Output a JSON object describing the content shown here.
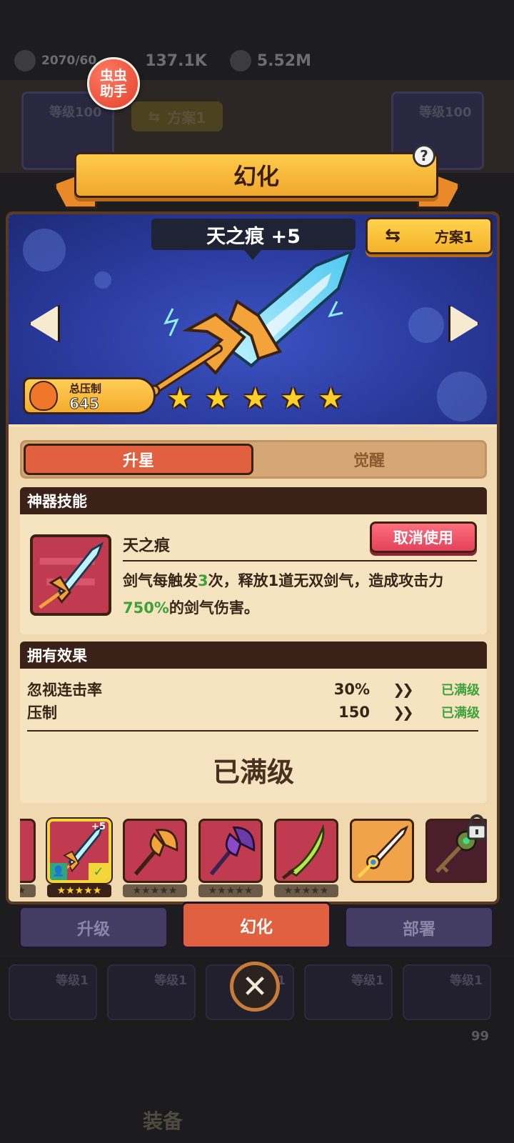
{
  "resources": {
    "energy": "2070/60",
    "gems": "137.1K",
    "gold": "5.52M"
  },
  "assistant_badge": "虫虫\n助手",
  "background": {
    "card_level": "等级100",
    "plan_label": "方案1",
    "slot_level": "等级1",
    "equip_label": "装备",
    "badge_count": "99"
  },
  "panel": {
    "title": "幻化",
    "help": "?",
    "weapon_name": "天之痕 +5",
    "plan_button": "方案1",
    "suppress_label": "总压制",
    "suppress_value": "645",
    "star_count": 5
  },
  "tabs": {
    "active": "升星",
    "inactive": "觉醒"
  },
  "skill": {
    "header": "神器技能",
    "name": "天之痕",
    "cancel_button": "取消使用",
    "desc_part1": "剑气每触发",
    "desc_num1": "3",
    "desc_part2": "次，释放1道无双剑气，造成攻击力",
    "desc_num2": "750%",
    "desc_part3": "的剑气伤害。"
  },
  "effects": {
    "header": "拥有效果",
    "rows": [
      {
        "name": "忽视连击率",
        "value": "30%",
        "status": "已满级"
      },
      {
        "name": "压制",
        "value": "150",
        "status": "已满级"
      }
    ],
    "max_text": "已满级"
  },
  "roster": {
    "selected_plus": "+5",
    "items": [
      "partial",
      "selected",
      "axe-orange",
      "axe-purple",
      "scimitar-green",
      "sword-gold",
      "key-locked"
    ]
  },
  "bottom_tabs": {
    "upgrade": "升级",
    "transform": "幻化",
    "deploy": "部署"
  },
  "close": "✕"
}
